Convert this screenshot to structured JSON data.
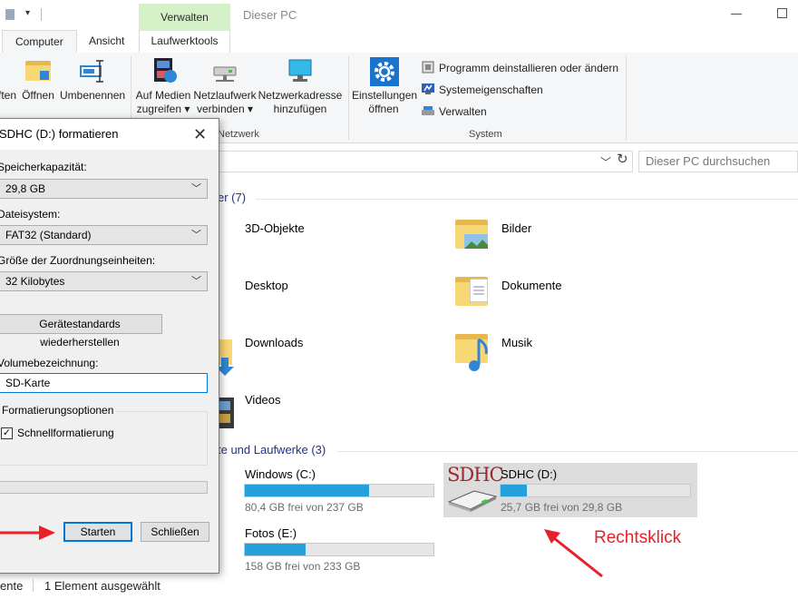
{
  "window": {
    "title": "Dieser PC",
    "context_tab": "Verwalten"
  },
  "ribbon_tabs": {
    "computer": "Computer",
    "ansicht": "Ansicht",
    "laufwerktools": "Laufwerktools"
  },
  "ribbon": {
    "btn_partial": "ften",
    "btn_oeffnen": "Öffnen",
    "btn_umbenennen": "Umbenennen",
    "btn_medien_1": "Auf Medien",
    "btn_medien_2": "zugreifen",
    "btn_netzlw_1": "Netzlaufwerk",
    "btn_netzlw_2": "verbinden",
    "btn_netzadr_1": "Netzwerkadresse",
    "btn_netzadr_2": "hinzufügen",
    "btn_einst_1": "Einstellungen",
    "btn_einst_2": "öffnen",
    "group_netzwerk": "Netzwerk",
    "group_system": "System",
    "small_items": [
      "Programm deinstallieren oder ändern",
      "Systemeigenschaften",
      "Verwalten"
    ]
  },
  "search": {
    "placeholder": "Dieser PC durchsuchen"
  },
  "content": {
    "folders_header": "er (7)",
    "folders": [
      "3D-Objekte",
      "Bilder",
      "Desktop",
      "Dokumente",
      "Downloads",
      "Musik",
      "Videos"
    ],
    "drives_header": "te und Laufwerke (3)",
    "drives": [
      {
        "name": "Windows  (C:)",
        "free": "80,4 GB frei von 237 GB",
        "used_fraction": 0.66
      },
      {
        "name": "SDHC (D:)",
        "free": "25,7 GB frei von 29,8 GB",
        "used_fraction": 0.14
      },
      {
        "name": "Fotos (E:)",
        "free": "158 GB frei von 233 GB",
        "used_fraction": 0.32
      }
    ],
    "sdhc_logo": "SDHC"
  },
  "statusbar": {
    "left_partial": "ente",
    "selection": "1 Element ausgewählt"
  },
  "dialog": {
    "title": "SDHC (D:) formatieren",
    "capacity_label": "Speicherkapazität:",
    "capacity_value": "29,8 GB",
    "filesystem_label": "Dateisystem:",
    "filesystem_value": "FAT32 (Standard)",
    "alloc_label": "Größe der Zuordnungseinheiten:",
    "alloc_value": "32 Kilobytes",
    "restore_button": "Gerätestandards wiederherstellen",
    "volume_label": "Volumebezeichnung:",
    "volume_value": "SD-Karte",
    "options_legend": "Formatierungsoptionen",
    "quick_format": "Schnellformatierung",
    "start_button": "Starten",
    "close_button": "Schließen"
  },
  "annotation": {
    "text": "Rechtsklick",
    "color": "#e8202a"
  }
}
